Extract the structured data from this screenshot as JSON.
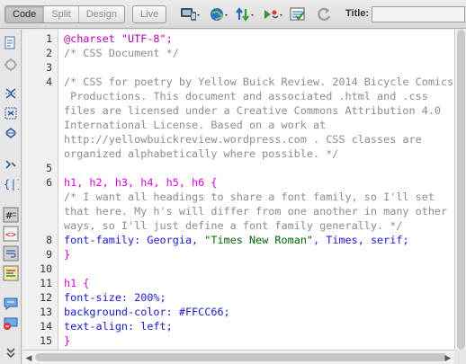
{
  "toolbar": {
    "view_modes": [
      {
        "label": "Code",
        "active": true
      },
      {
        "label": "Split",
        "active": false
      },
      {
        "label": "Design",
        "active": false
      }
    ],
    "live_label": "Live",
    "title_label": "Title:",
    "title_value": "",
    "icons": [
      "multiscreen-icon",
      "preview-globe-icon",
      "file-transfer-icon",
      "debug-icon",
      "visual-aids-icon",
      "refresh-icon"
    ]
  },
  "gutter_tools": [
    "open-documents-icon",
    "show-code-navigator-icon",
    "collapse-full-tag-icon",
    "collapse-selection-icon",
    "expand-all-icon",
    "select-parent-tag-icon",
    "balance-braces-icon",
    "line-numbers-icon",
    "highlight-invalid-code-icon",
    "word-wrap-icon",
    "syntax-coloring-icon",
    "apply-comment-icon",
    "remove-comment-icon",
    "more-tools-icon"
  ],
  "editor": {
    "lines": [
      {
        "n": "1",
        "parts": [
          {
            "t": "@charset \"UTF-8\";",
            "c": "c-purple"
          }
        ]
      },
      {
        "n": "2",
        "parts": [
          {
            "t": "/* CSS Document */",
            "c": "c-comment"
          }
        ]
      },
      {
        "n": "3",
        "parts": []
      },
      {
        "n": "4",
        "wrap": true,
        "parts": [
          {
            "t": "/* CSS for poetry by Yellow Buick Review. 2014 Bicycle Comics\n Productions. This document and associated .html and .css\nfiles are licensed under a Creative Commons Attribution 4.0\nInternational License. Based on a work at\nhttp://yellowbuickreview.wordpress.com . CSS classes are\norganized alphabetically where possible. */",
            "c": "c-comment"
          }
        ]
      },
      {
        "n": "5",
        "parts": []
      },
      {
        "n": "6",
        "parts": [
          {
            "t": "h1, h2, h3, h4, h5, h6 {",
            "c": "c-selector"
          }
        ]
      },
      {
        "n": "",
        "wrap": true,
        "parts": [
          {
            "t": "/* I want all headings to share a font family, so I'll set\nthat here. My h's will differ from one another in many other\nways, so I'll just define a font family generally. */",
            "c": "c-comment"
          }
        ]
      },
      {
        "n": "8",
        "parts": [
          {
            "t": "font-family",
            "c": "c-prop"
          },
          {
            "t": ": Georgia, ",
            "c": "c-value"
          },
          {
            "t": "\"Times New Roman\"",
            "c": "c-string"
          },
          {
            "t": ", Times, serif;",
            "c": "c-value"
          }
        ]
      },
      {
        "n": "9",
        "parts": [
          {
            "t": "}",
            "c": "c-brace"
          }
        ]
      },
      {
        "n": "10",
        "parts": []
      },
      {
        "n": "11",
        "parts": [
          {
            "t": "h1 {",
            "c": "c-selector"
          }
        ]
      },
      {
        "n": "12",
        "parts": [
          {
            "t": "font-size",
            "c": "c-prop"
          },
          {
            "t": ": 200%;",
            "c": "c-value"
          }
        ]
      },
      {
        "n": "13",
        "parts": [
          {
            "t": "background-color",
            "c": "c-prop"
          },
          {
            "t": ": #FFCC66;",
            "c": "c-value"
          }
        ]
      },
      {
        "n": "14",
        "parts": [
          {
            "t": "text-align",
            "c": "c-prop"
          },
          {
            "t": ": left;",
            "c": "c-value"
          }
        ]
      },
      {
        "n": "15",
        "parts": [
          {
            "t": "}",
            "c": "c-brace"
          }
        ]
      }
    ]
  }
}
